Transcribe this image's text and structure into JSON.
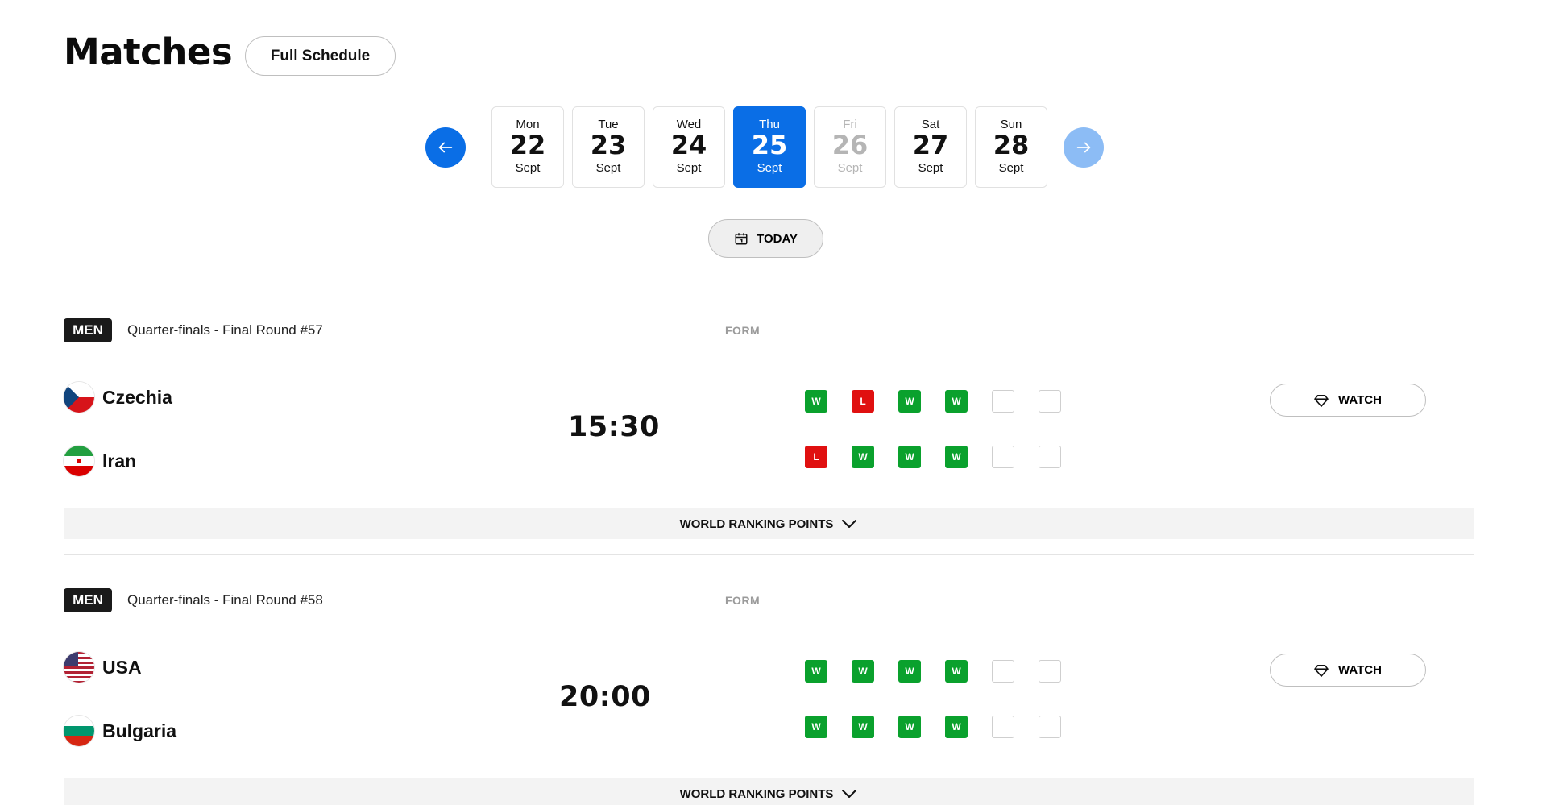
{
  "header": {
    "title": "Matches",
    "full_schedule_label": "Full Schedule"
  },
  "dates": [
    {
      "dow": "Mon",
      "day": "22",
      "month": "Sept",
      "state": "normal"
    },
    {
      "dow": "Tue",
      "day": "23",
      "month": "Sept",
      "state": "normal"
    },
    {
      "dow": "Wed",
      "day": "24",
      "month": "Sept",
      "state": "normal"
    },
    {
      "dow": "Thu",
      "day": "25",
      "month": "Sept",
      "state": "active"
    },
    {
      "dow": "Fri",
      "day": "26",
      "month": "Sept",
      "state": "disabled"
    },
    {
      "dow": "Sat",
      "day": "27",
      "month": "Sept",
      "state": "normal"
    },
    {
      "dow": "Sun",
      "day": "28",
      "month": "Sept",
      "state": "normal"
    }
  ],
  "today_label": "TODAY",
  "colors": {
    "accent": "#0a6ee6",
    "win": "#0aa12d",
    "loss": "#e01010",
    "badge": "#1a1a1a"
  },
  "matches": [
    {
      "gender": "MEN",
      "round": "Quarter-finals - Final Round #57",
      "time": "15:30",
      "form_label": "FORM",
      "watch_label": "WATCH",
      "ranking_label": "WORLD RANKING POINTS",
      "teams": [
        {
          "name": "Czechia",
          "flag": "czechia-flag-icon",
          "form": [
            "W",
            "L",
            "W",
            "W",
            "",
            ""
          ]
        },
        {
          "name": "Iran",
          "flag": "iran-flag-icon",
          "form": [
            "L",
            "W",
            "W",
            "W",
            "",
            ""
          ]
        }
      ]
    },
    {
      "gender": "MEN",
      "round": "Quarter-finals - Final Round #58",
      "time": "20:00",
      "form_label": "FORM",
      "watch_label": "WATCH",
      "ranking_label": "WORLD RANKING POINTS",
      "teams": [
        {
          "name": "USA",
          "flag": "usa-flag-icon",
          "form": [
            "W",
            "W",
            "W",
            "W",
            "",
            ""
          ]
        },
        {
          "name": "Bulgaria",
          "flag": "bulgaria-flag-icon",
          "form": [
            "W",
            "W",
            "W",
            "W",
            "",
            ""
          ]
        }
      ]
    }
  ]
}
